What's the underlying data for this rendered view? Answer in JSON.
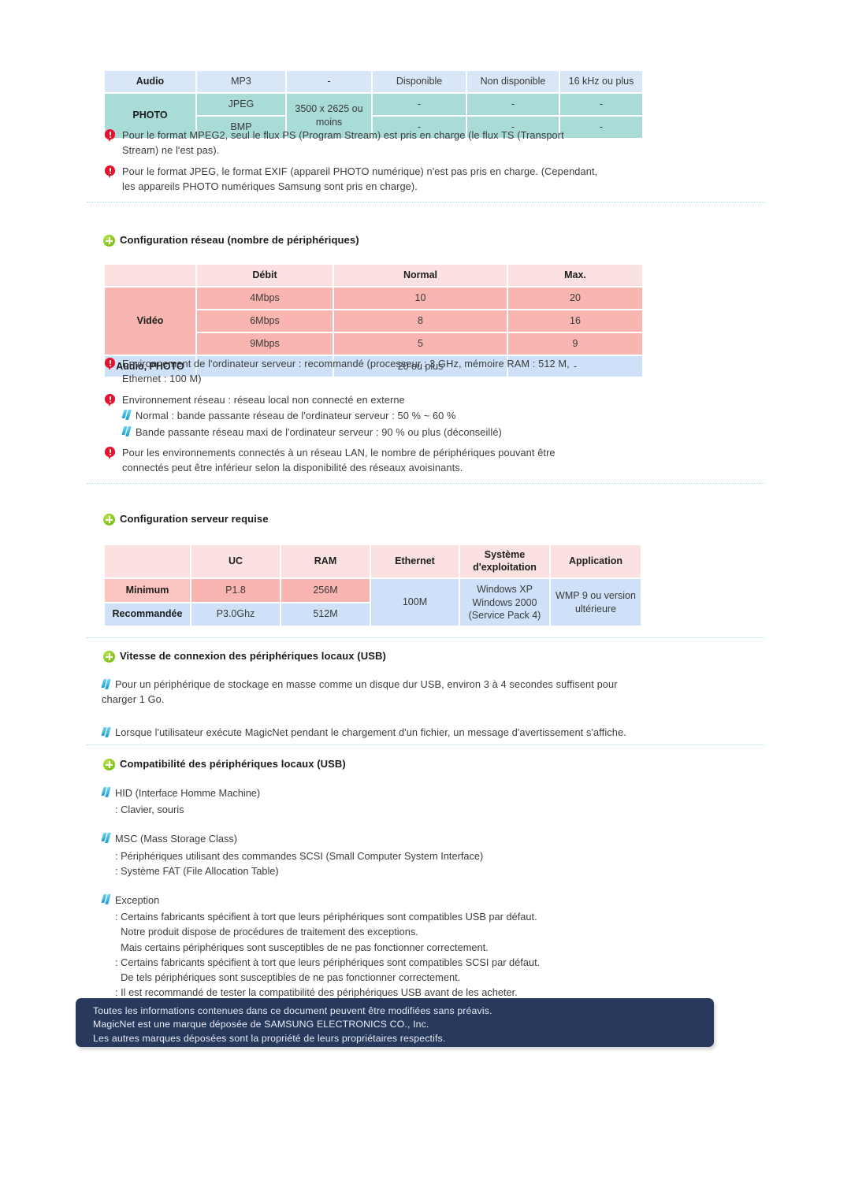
{
  "codec_table": {
    "rows": [
      {
        "label": "Audio",
        "tone": "blue",
        "cells": [
          "MP3",
          "-",
          "Disponible",
          "Non disponible",
          "16 kHz ou plus"
        ]
      },
      {
        "label": "PHOTO",
        "tone": "aqua",
        "cells": [
          "JPEG",
          "3500 x 2625 ou moins",
          "-",
          "-",
          "-"
        ]
      },
      {
        "label": "",
        "tone": "aqua",
        "cells": [
          "BMP",
          "",
          "-",
          "-",
          "-"
        ]
      }
    ],
    "photo_resolution": "3500 x 2625 ou moins"
  },
  "codec_notes": [
    {
      "icon": "warning-icon",
      "lines": [
        "Pour le format MPEG2, seul le flux PS (Program Stream) est pris en charge (le flux TS (Transport",
        "Stream) ne l'est pas)."
      ]
    },
    {
      "icon": "warning-icon",
      "lines": [
        "Pour le format JPEG, le format EXIF (appareil PHOTO numérique) n'est pas pris en charge. (Cependant,",
        "les appareils PHOTO numériques Samsung sont pris en charge)."
      ]
    }
  ],
  "network_section": {
    "title": "Configuration réseau (nombre de périphériques)",
    "table": {
      "headers": [
        "",
        "Débit",
        "Normal",
        "Max."
      ],
      "video_label": "Vidéo",
      "video_rows": [
        {
          "debit": "4Mbps",
          "normal": "10",
          "max": "20"
        },
        {
          "debit": "6Mbps",
          "normal": "8",
          "max": "16"
        },
        {
          "debit": "9Mbps",
          "normal": "5",
          "max": "9"
        }
      ],
      "audio_row": {
        "label": "Audio, PHOTO",
        "debit": "-",
        "normal": "20 ou plus",
        "max": "-"
      }
    },
    "notes": [
      {
        "icon": "warning-icon",
        "lines": [
          "Environnement de l'ordinateur serveur : recommandé (processeur : 3 GHz, mémoire RAM : 512 M,",
          "Ethernet : 100 M)"
        ]
      },
      {
        "icon": "warning-icon",
        "lines": [
          "Environnement réseau : réseau local non connecté en externe"
        ],
        "subs": [
          "Normal : bande passante réseau de l'ordinateur serveur : 50 % ~ 60 %",
          "Bande passante réseau maxi de l'ordinateur serveur : 90 % ou plus (déconseillé)"
        ]
      },
      {
        "icon": "warning-icon",
        "lines": [
          "Pour les environnements connectés à un réseau LAN, le nombre de périphériques pouvant être",
          "connectés peut être inférieur selon la disponibilité des réseaux avoisinants."
        ]
      }
    ]
  },
  "server_section": {
    "title": "Configuration serveur requise",
    "table": {
      "headers": [
        "",
        "UC",
        "RAM",
        "Ethernet",
        "Système d'exploitation",
        "Application"
      ],
      "header_os_line1": "Système",
      "header_os_line2": "d'exploitation",
      "rows": [
        {
          "label": "Minimum",
          "uc": "P1.8",
          "ram": "256M"
        },
        {
          "label": "Recommandée",
          "uc": "P3.0Ghz",
          "ram": "512M"
        }
      ],
      "ethernet": "100M",
      "os_lines": [
        "Windows XP",
        "Windows 2000",
        "(Service Pack 4)"
      ],
      "application_lines": [
        "WMP 9 ou version",
        "ultérieure"
      ]
    }
  },
  "usb_speed_section": {
    "title": "Vitesse de connexion des périphériques locaux (USB)",
    "notes": [
      {
        "icon": "chevron-icon",
        "lines": [
          "Pour un périphérique de stockage en masse comme un disque dur USB, environ 3 à 4 secondes suffisent pour",
          "charger 1 Go."
        ]
      },
      {
        "icon": "chevron-icon",
        "lines": [
          "Lorsque l'utilisateur exécute MagicNet pendant le chargement d'un fichier, un message d'avertissement s'affiche."
        ]
      }
    ]
  },
  "usb_compat_section": {
    "title": "Compatibilité des périphériques locaux (USB)",
    "groups": [
      {
        "icon": "chevron-icon",
        "heading": "HID (Interface Homme Machine)",
        "items": [
          ": Clavier, souris"
        ]
      },
      {
        "icon": "chevron-icon",
        "heading": "MSC (Mass Storage Class)",
        "items": [
          ": Périphériques utilisant des commandes SCSI (Small Computer System Interface)",
          ": Système FAT (File Allocation Table)"
        ]
      },
      {
        "icon": "chevron-icon",
        "heading": "Exception",
        "items": [
          ": Certains fabricants spécifient à tort que leurs périphériques sont compatibles USB par défaut.",
          "  Notre produit dispose de procédures de traitement des exceptions.",
          "  Mais certains périphériques sont susceptibles de ne pas fonctionner correctement.",
          ": Certains fabricants spécifient à tort que leurs périphériques sont compatibles SCSI par défaut.",
          "  De tels périphériques sont susceptibles de ne pas fonctionner correctement.",
          ": Il est recommandé de tester la compatibilité des périphériques USB avant de les acheter."
        ]
      }
    ]
  },
  "footer": {
    "lines": [
      "Toutes les informations contenues dans ce document peuvent être modifiées sans préavis.",
      "MagicNet est une marque déposée de SAMSUNG ELECTRONICS CO., Inc.",
      "Les autres marques déposées sont la propriété de leurs propriétaires respectifs."
    ]
  },
  "colors": {
    "codec_blue": "#d8e6f8",
    "codec_aqua": "#a9dbd7",
    "pink_header": "#fce1e1",
    "pink_body": "#f9b5af",
    "blue_body": "#cfe1f8",
    "warning_red": "#e8102a",
    "plus_green": "#86c71b",
    "chevron_blue": "#1b9fd0",
    "footer_navy": "#27395c"
  }
}
